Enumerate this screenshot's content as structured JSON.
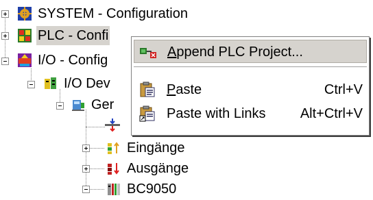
{
  "tree": {
    "nodes": [
      {
        "label": "SYSTEM - Configuration",
        "icon": "system-config-icon",
        "expander": "plus"
      },
      {
        "label": "PLC - Confi",
        "icon": "plc-config-icon",
        "expander": "plus",
        "selected": true
      },
      {
        "label": "I/O - Config",
        "icon": "io-config-icon",
        "expander": "minus"
      },
      {
        "label": "I/O Dev",
        "icon": "io-devices-icon",
        "expander": "minus"
      },
      {
        "label": "Ger",
        "icon": "device-icon",
        "expander": "minus"
      },
      {
        "label": "",
        "icon": "bus-coupler-icon",
        "expander": "none"
      },
      {
        "label": "Eingänge",
        "icon": "inputs-icon",
        "expander": "plus"
      },
      {
        "label": "Ausgänge",
        "icon": "outputs-icon",
        "expander": "plus"
      },
      {
        "label": "BC9050",
        "icon": "bc9050-icon",
        "expander": "minus"
      }
    ]
  },
  "context_menu": {
    "items": [
      {
        "label_u": "A",
        "label_rest": "ppend PLC Project...",
        "shortcut": "",
        "icon": "append-plc-project-icon",
        "highlighted": true
      },
      {
        "label_u": "P",
        "label_rest": "aste",
        "shortcut": "Ctrl+V",
        "icon": "paste-icon",
        "highlighted": false
      },
      {
        "label_u": "",
        "label_rest": "Paste with Links",
        "shortcut": "Alt+Ctrl+V",
        "icon": "paste-with-links-icon",
        "highlighted": false
      }
    ]
  },
  "colors": {
    "highlight": "#d6d3ce",
    "background": "#ffffff"
  }
}
